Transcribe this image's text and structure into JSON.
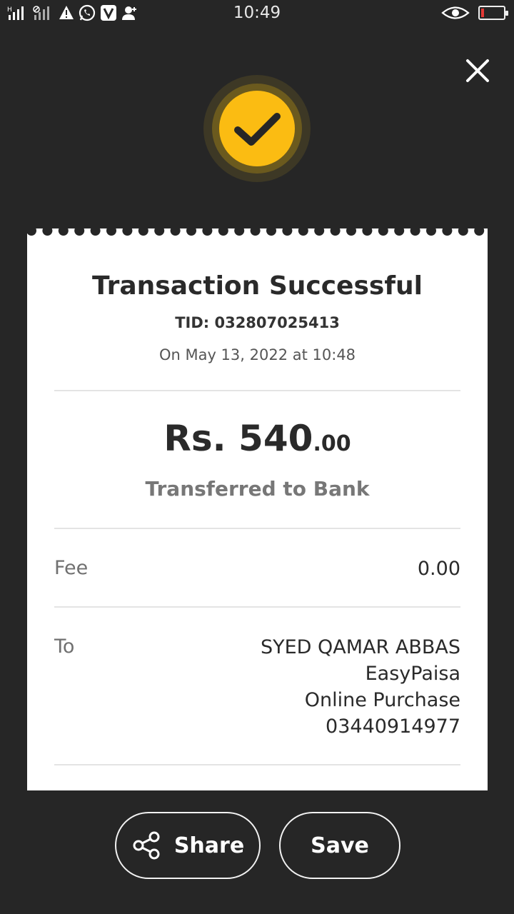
{
  "status_bar": {
    "time": "10:49",
    "battery_level": 0.12,
    "left_icons": [
      "signal-h-icon",
      "signal-off-icon",
      "warning-icon",
      "whatsapp-icon",
      "viber-icon",
      "user-add-icon"
    ],
    "right_icons": [
      "eye-icon",
      "battery-icon"
    ]
  },
  "receipt": {
    "title": "Transaction Successful",
    "tid": "TID: 032807025413",
    "datetime": "On May 13, 2022 at 10:48",
    "amount_main": "Rs. 540",
    "amount_decimal": ".00",
    "transfer_type": "Transferred to Bank",
    "fee_label": "Fee",
    "fee_value": "0.00",
    "to_label": "To",
    "to_lines": [
      "SYED QAMAR ABBAS",
      "EasyPaisa",
      "Online Purchase",
      "03440914977"
    ]
  },
  "actions": {
    "share_label": "Share",
    "save_label": "Save"
  },
  "colors": {
    "background": "#262626",
    "accent": "#fbbc12",
    "battery_low": "#e53935"
  }
}
